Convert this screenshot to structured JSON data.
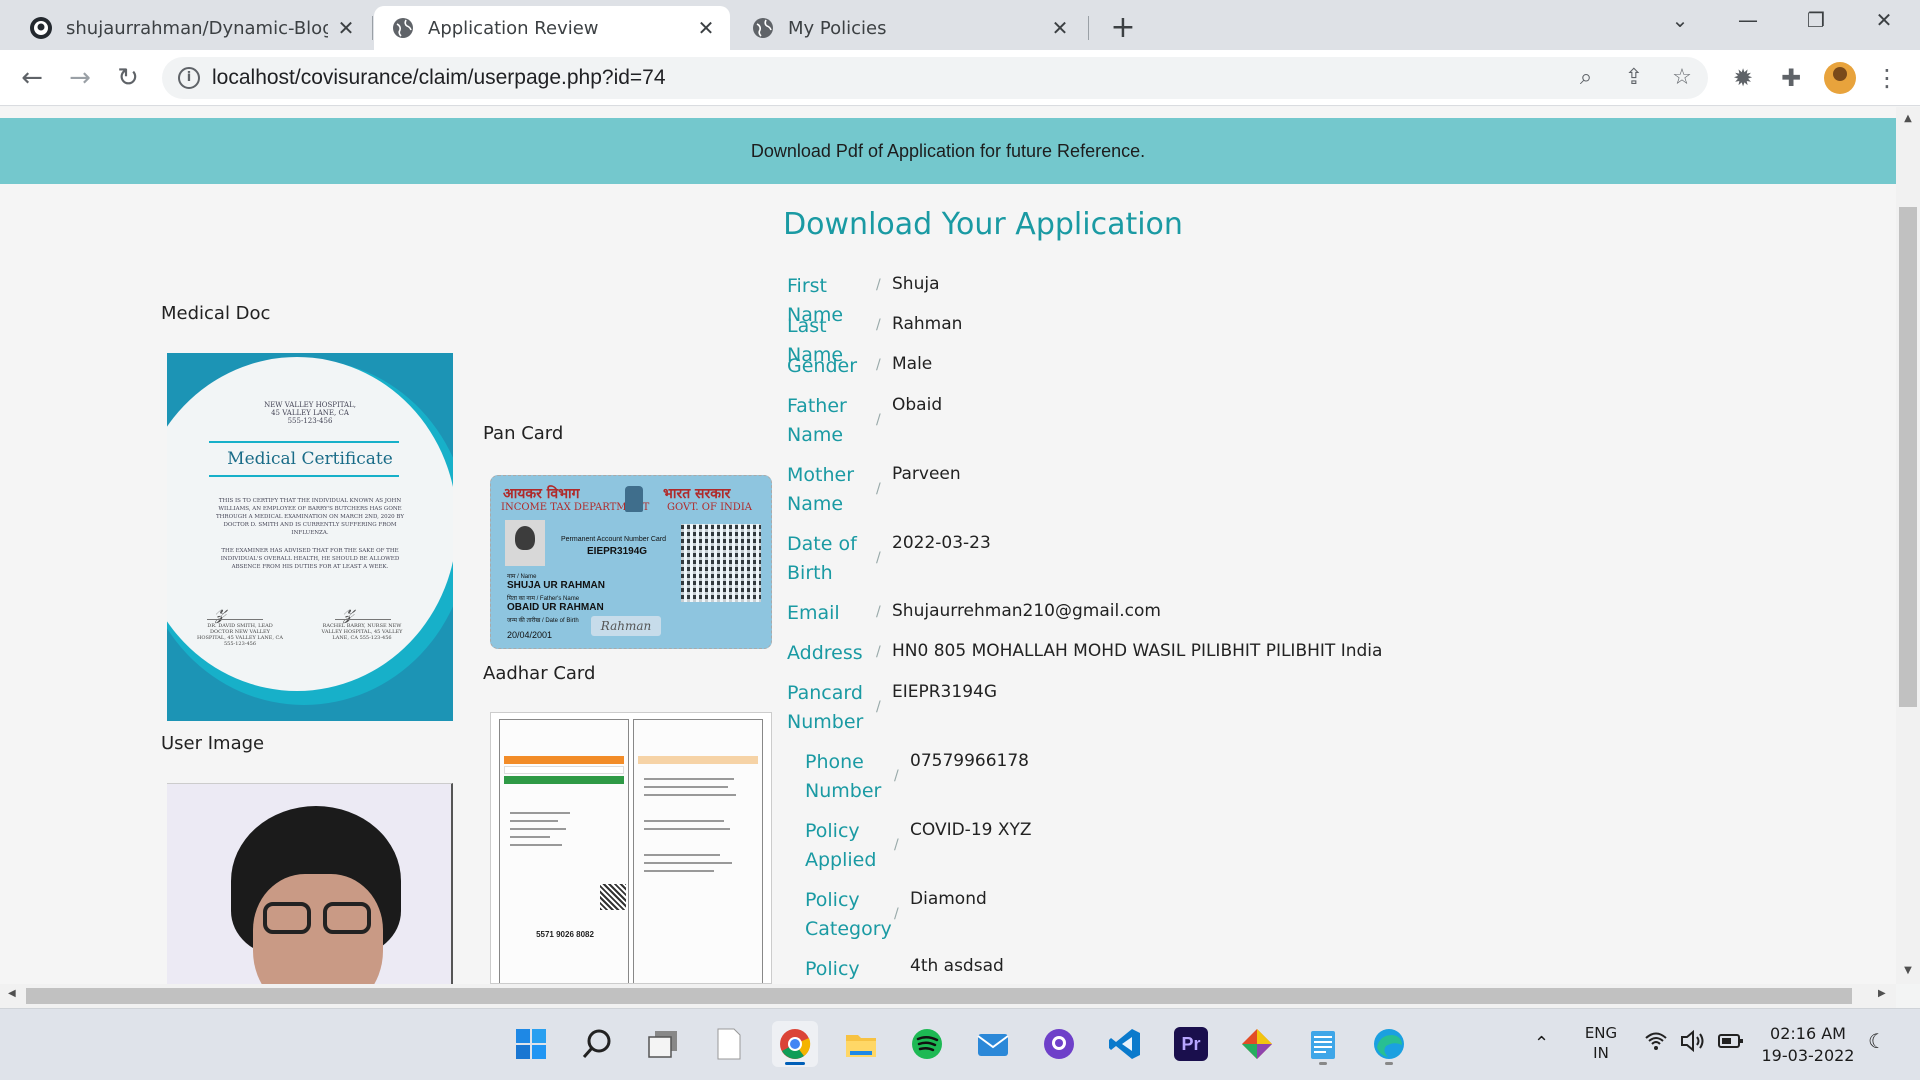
{
  "browser": {
    "tabs": [
      {
        "title": "shujaurrahman/Dynamic-Blogger",
        "favicon": "github-icon"
      },
      {
        "title": "Application Review",
        "favicon": "globe-icon",
        "active": true
      },
      {
        "title": "My Policies",
        "favicon": "globe-icon"
      }
    ],
    "url": "localhost/covisurance/claim/userpage.php?id=74"
  },
  "page": {
    "banner_text": "Download Pdf of Application for future Reference.",
    "title": "Download Your Application",
    "accent_color": "#1a9aa3",
    "banner_color": "#74c8cd"
  },
  "documents": {
    "medical_label": "Medical Doc",
    "pan_label": "Pan Card",
    "aadhar_label": "Aadhar Card",
    "user_image_label": "User Image",
    "medical_cert": {
      "hospital_lines": [
        "NEW VALLEY HOSPITAL,",
        "45 VALLEY LANE, CA",
        "555-123-456"
      ],
      "title": "Medical Certificate",
      "body_1": "THIS IS TO CERTIFY THAT THE INDIVIDUAL KNOWN AS JOHN WILLIAMS, AN EMPLOYEE OF BARRY'S BUTCHERS HAS GONE THROUGH A MEDICAL EXAMINATION ON MARCH 2ND, 2020 BY DOCTOR D. SMITH AND IS CURRENTLY SUFFERING FROM INFLUENZA.",
      "body_2": "THE EXAMINER HAS ADVISED THAT FOR THE SAKE OF THE INDIVIDUAL'S OVERALL HEALTH, HE SHOULD BE ALLOWED ABSENCE FROM HIS DUTIES FOR AT LEAST A WEEK.",
      "signer_1": "DR. DAVID SMITH, LEAD DOCTOR NEW VALLEY HOSPITAL, 45 VALLEY LANE, CA 555-123-456",
      "signer_2": "RACHEL BARRY, NURSE NEW VALLEY HOSPITAL, 45 VALLEY LANE, CA 555-123-456"
    },
    "pan": {
      "hdr_left": "आयकर विभाग",
      "hdr_right": "भारत सरकार",
      "sub_left": "INCOME TAX DEPARTMENT",
      "sub_right": "GOVT. OF INDIA",
      "number_caption": "Permanent Account Number Card",
      "number": "EIEPR3194G",
      "name_caption": "नाम / Name",
      "name": "SHUJA UR RAHMAN",
      "father_caption": "पिता का नाम / Father's Name",
      "father": "OBAID UR RAHMAN",
      "dob_caption": "जन्म की तारीख / Date of Birth",
      "dob": "20/04/2001",
      "signature": "Rahman"
    },
    "aadhar": {
      "number": "5571 9026 8082"
    }
  },
  "details": [
    {
      "label": "First Name",
      "value": "Shuja"
    },
    {
      "label": "Last Name",
      "value": "Rahman"
    },
    {
      "label": "Gender",
      "value": "Male"
    },
    {
      "label": "Father Name",
      "value": "Obaid"
    },
    {
      "label": "Mother Name",
      "value": "Parveen"
    },
    {
      "label": "Date of Birth",
      "value": "2022-03-23"
    },
    {
      "label": "Email",
      "value": "Shujaurrehman210@gmail.com"
    },
    {
      "label": "Address",
      "value": "HN0 805 MOHALLAH MOHD WASIL PILIBHIT PILIBHIT India"
    },
    {
      "label": "Pancard Number",
      "value": "EIEPR3194G"
    },
    {
      "label": "Phone Number",
      "value": "07579966178"
    },
    {
      "label": "Policy Applied",
      "value": "COVID-19 XYZ"
    },
    {
      "label": "Policy Category",
      "value": "Diamond"
    },
    {
      "label": "Policy",
      "value": "4th asdsad"
    }
  ],
  "separator": "/",
  "taskbar": {
    "apps": [
      "windows-start-icon",
      "search-icon",
      "task-view-icon",
      "notepad-file-icon",
      "chrome-icon",
      "file-explorer-icon",
      "spotify-icon",
      "mail-icon",
      "github-desktop-icon",
      "vscode-icon",
      "premiere-pro-icon",
      "git-kraken-icon",
      "notepad-icon",
      "edge-icon"
    ],
    "language_top": "ENG",
    "language_bottom": "IN",
    "time": "02:16 AM",
    "date": "19-03-2022"
  }
}
